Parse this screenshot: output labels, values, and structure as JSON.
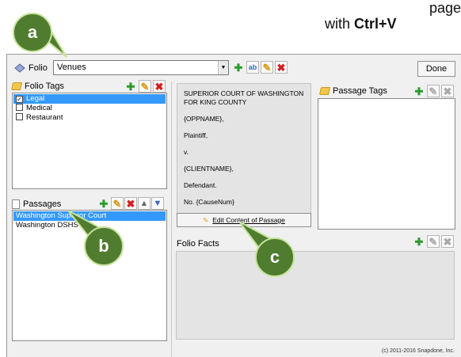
{
  "hint": {
    "line1": "page",
    "line2_prefix": "with ",
    "line2_key": "Ctrl+V"
  },
  "toolbar": {
    "folio_label": "Folio",
    "folio_value": "Venues",
    "done_label": "Done"
  },
  "folio_tags": {
    "title": "Folio Tags",
    "items": [
      {
        "label": "Legal",
        "checked": true,
        "selected": true
      },
      {
        "label": "Medical",
        "checked": false,
        "selected": false
      },
      {
        "label": "Restaurant",
        "checked": false,
        "selected": false
      }
    ]
  },
  "passages": {
    "title": "Passages",
    "items": [
      {
        "label": "Washington Superior Court",
        "selected": true
      },
      {
        "label": "Washington DSHS",
        "selected": false
      }
    ]
  },
  "passage_content": {
    "lines": [
      "SUPERIOR COURT OF WASHINGTON FOR KING COUNTY",
      "{OPPNAME},",
      "Plaintiff,",
      "v.",
      "{CLIENTNAME},",
      "Defendant.",
      "No. {CauseNum}"
    ],
    "edit_button": "Edit Content of Passage"
  },
  "passage_tags": {
    "title": "Passage Tags"
  },
  "folio_facts": {
    "title": "Folio Facts"
  },
  "copyright": "(c) 2011-2016 Snapdone, Inc.",
  "callouts": {
    "a": "a",
    "b": "b",
    "c": "c"
  },
  "colors": {
    "accent_green": "#4f7c2f",
    "selection": "#3399ff"
  }
}
